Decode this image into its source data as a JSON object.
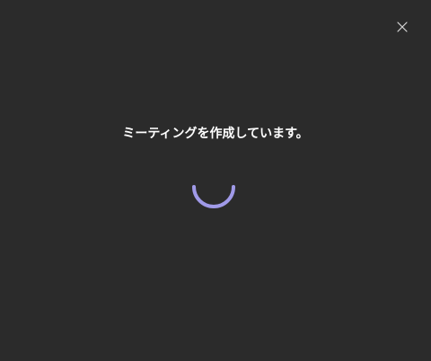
{
  "dialog": {
    "status_message": "ミーティングを作成しています。",
    "close_icon": "close-icon",
    "spinner_icon": "loading-spinner-icon"
  },
  "colors": {
    "background": "#2b2b2b",
    "text": "#ffffff",
    "close_icon": "#d6d6d6",
    "spinner_accent": "#a09ae8"
  }
}
